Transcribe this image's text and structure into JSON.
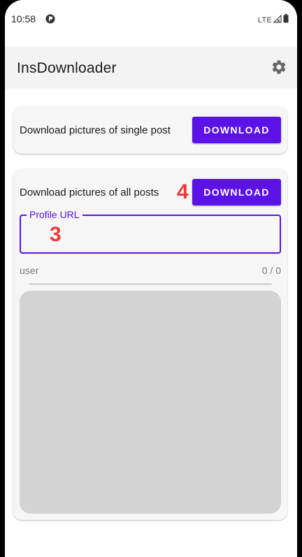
{
  "status_bar": {
    "time": "10:58",
    "network": "LTE"
  },
  "app_bar": {
    "title": "InsDownloader",
    "settings_icon": "gear-icon"
  },
  "single_post": {
    "label": "Download pictures of single post",
    "button_label": "DOWNLOAD"
  },
  "all_posts": {
    "label": "Download pictures of all posts",
    "button_label": "DOWNLOAD",
    "profile_url": {
      "label": "Profile URL",
      "value": ""
    },
    "user": "user",
    "count": "0 / 0",
    "progress": 0
  },
  "annotations": {
    "marker_button": "4",
    "marker_field": "3"
  },
  "colors": {
    "accent": "#5b12e6",
    "marker": "#f03a3a",
    "card_bg": "#f6f6f6"
  }
}
